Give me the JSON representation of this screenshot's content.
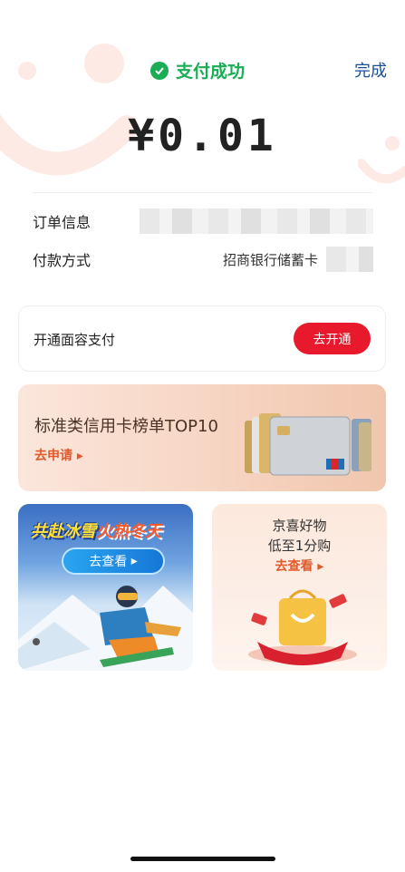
{
  "header": {
    "status_text": "支付成功",
    "done_label": "完成"
  },
  "payment": {
    "amount": "¥0.01"
  },
  "order_info": {
    "order_label": "订单信息",
    "method_label": "付款方式",
    "method_value": "招商银行储蓄卡"
  },
  "face_pay": {
    "title": "开通面容支付",
    "button_label": "去开通"
  },
  "banners": {
    "credit": {
      "title": "标准类信用卡榜单TOP10",
      "link": "去申请"
    },
    "ski": {
      "title_part1": "共赴冰雪",
      "title_part2": "火热冬天",
      "button": "去查看"
    },
    "jingxi": {
      "title": "京喜好物",
      "subtitle": "低至1分购",
      "link": "去查看"
    }
  },
  "colors": {
    "success": "#1aad55",
    "accent_red": "#e8192c",
    "done_blue": "#1a4f9c"
  }
}
